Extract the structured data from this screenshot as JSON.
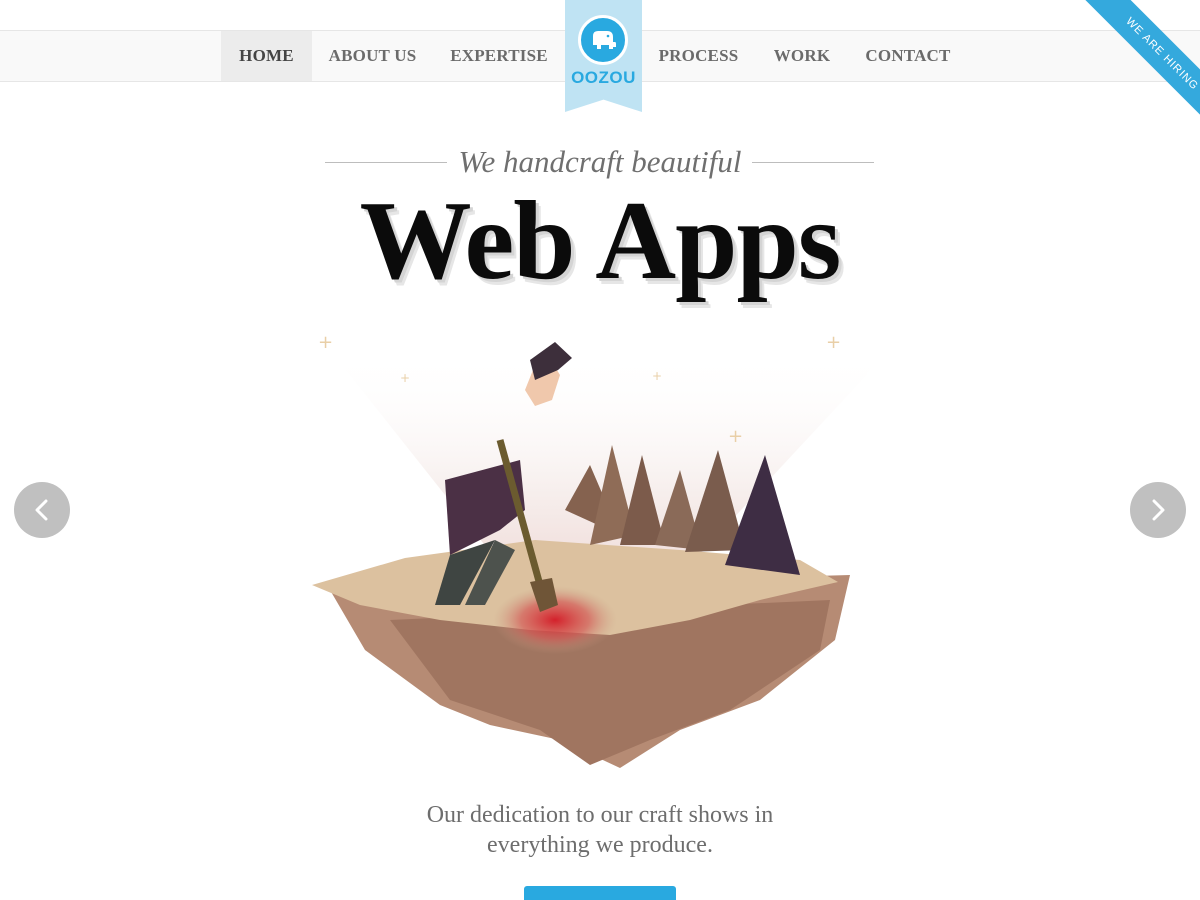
{
  "nav": {
    "items": [
      {
        "label": "HOME",
        "active": true
      },
      {
        "label": "ABOUT US",
        "active": false
      },
      {
        "label": "EXPERTISE",
        "active": false
      },
      {
        "label": "PROCESS",
        "active": false
      },
      {
        "label": "WORK",
        "active": false
      },
      {
        "label": "CONTACT",
        "active": false
      }
    ],
    "logo_text": "OOZOU",
    "hiring_label": "WE ARE HIRING"
  },
  "hero": {
    "tagline": "We handcraft beautiful",
    "headline": "Web Apps",
    "description_line1": "Our dedication to our craft shows in",
    "description_line2": "everything we produce."
  },
  "icons": {
    "logo": "elephant-icon",
    "prev": "chevron-left-icon",
    "next": "chevron-right-icon"
  },
  "colors": {
    "accent": "#29a9e0",
    "logo_ribbon": "#bfe3f3",
    "nav_background": "#f9f9f9",
    "nav_active": "#ececec",
    "headline": "#0b0b0b",
    "body_text": "#6d6d6d"
  }
}
